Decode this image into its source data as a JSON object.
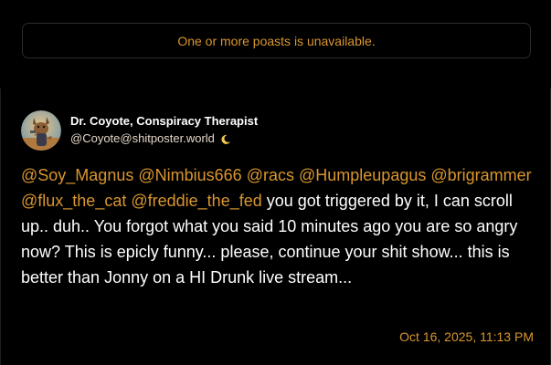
{
  "notice": {
    "text": "One or more poasts is unavailable."
  },
  "post": {
    "author": {
      "display_name": "Dr. Coyote, Conspiracy Therapist",
      "handle": "@Coyote@shitposter.world",
      "avatar_icon": "coyote-avatar-icon",
      "badge_icon": "crescent-moon-icon"
    },
    "mentions": [
      "@Soy_Magnus",
      "@Nimbius666",
      "@racs",
      "@Humpleupagus",
      "@brigrammer",
      "@flux_the_cat",
      "@freddie_the_fed"
    ],
    "body_text": "you got triggered by it, I can scroll up.. duh.. You forgot what you said 10 minutes ago you are so angry now? This is epicly funny... please, continue your shit show... this is better than Jonny on a HI Drunk live stream...",
    "timestamp": "Oct 16, 2025, 11:13 PM"
  },
  "colors": {
    "background": "#000000",
    "accent": "#d9962f",
    "text": "#ffffff",
    "border": "#2b2b2b"
  }
}
